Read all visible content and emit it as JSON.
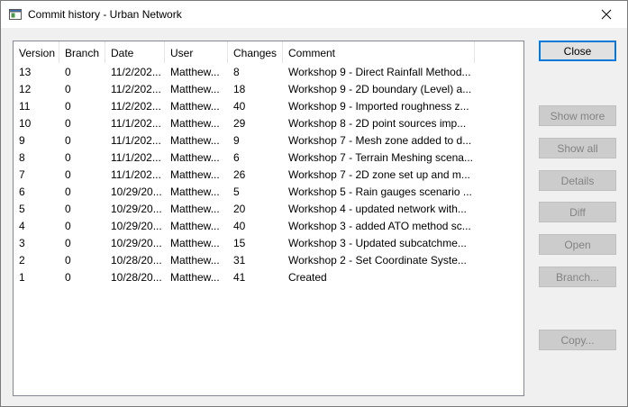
{
  "window": {
    "title": "Commit history - Urban Network"
  },
  "columns": [
    {
      "label": "Version"
    },
    {
      "label": "Branch"
    },
    {
      "label": "Date"
    },
    {
      "label": "User"
    },
    {
      "label": "Changes"
    },
    {
      "label": "Comment"
    }
  ],
  "rows": [
    {
      "version": "13",
      "branch": "0",
      "date": "11/2/202...",
      "user": "Matthew...",
      "changes": "8",
      "comment": "Workshop 9 - Direct Rainfall Method..."
    },
    {
      "version": "12",
      "branch": "0",
      "date": "11/2/202...",
      "user": "Matthew...",
      "changes": "18",
      "comment": "Workshop 9 - 2D boundary (Level) a..."
    },
    {
      "version": "11",
      "branch": "0",
      "date": "11/2/202...",
      "user": "Matthew...",
      "changes": "40",
      "comment": "Workshop 9 - Imported roughness z..."
    },
    {
      "version": "10",
      "branch": "0",
      "date": "11/1/202...",
      "user": "Matthew...",
      "changes": "29",
      "comment": "Workshop 8 - 2D point sources imp..."
    },
    {
      "version": "9",
      "branch": "0",
      "date": "11/1/202...",
      "user": "Matthew...",
      "changes": "9",
      "comment": "Workshop 7 - Mesh zone added to d..."
    },
    {
      "version": "8",
      "branch": "0",
      "date": "11/1/202...",
      "user": "Matthew...",
      "changes": "6",
      "comment": "Workshop 7 - Terrain Meshing scena..."
    },
    {
      "version": "7",
      "branch": "0",
      "date": "11/1/202...",
      "user": "Matthew...",
      "changes": "26",
      "comment": "Workshop 7 - 2D zone set up and m..."
    },
    {
      "version": "6",
      "branch": "0",
      "date": "10/29/20...",
      "user": "Matthew...",
      "changes": "5",
      "comment": "Workshop 5 - Rain gauges scenario ..."
    },
    {
      "version": "5",
      "branch": "0",
      "date": "10/29/20...",
      "user": "Matthew...",
      "changes": "20",
      "comment": "Workshop 4 - updated network with..."
    },
    {
      "version": "4",
      "branch": "0",
      "date": "10/29/20...",
      "user": "Matthew...",
      "changes": "40",
      "comment": "Workshop 3 - added ATO method sc..."
    },
    {
      "version": "3",
      "branch": "0",
      "date": "10/29/20...",
      "user": "Matthew...",
      "changes": "15",
      "comment": "Workshop 3 - Updated subcatchme..."
    },
    {
      "version": "2",
      "branch": "0",
      "date": "10/28/20...",
      "user": "Matthew...",
      "changes": "31",
      "comment": "Workshop 2 - Set Coordinate Syste..."
    },
    {
      "version": "1",
      "branch": "0",
      "date": "10/28/20...",
      "user": "Matthew...",
      "changes": "41",
      "comment": "Created"
    }
  ],
  "buttons": {
    "close": "Close",
    "show_more": "Show more",
    "show_all": "Show all",
    "details": "Details",
    "diff": "Diff",
    "open": "Open",
    "branch": "Branch...",
    "copy": "Copy..."
  }
}
